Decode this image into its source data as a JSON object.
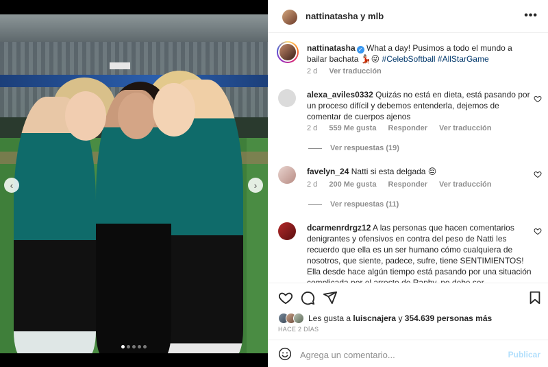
{
  "header": {
    "title": "nattinatasha y mlb",
    "more_icon": "more-horizontal-icon"
  },
  "carousel": {
    "prev_icon": "‹",
    "next_icon": "›",
    "slide_count": 5,
    "active_slide": 1
  },
  "caption": {
    "username": "nattinatasha",
    "verified": "✓",
    "text": "What a day! Pusimos a todo el mundo a bailar bachata 💃🏻😜",
    "hashtags": [
      "#CelebSoftball",
      "#AllStarGame"
    ],
    "age": "2 d",
    "translate": "Ver traducción"
  },
  "comments": [
    {
      "username": "alexa_aviles0332",
      "text": "Quizás no está en dieta, está pasando por un proceso difícil y debemos entenderla, dejemos de comentar de cuerpos ajenos",
      "age": "2 d",
      "likes": "559 Me gusta",
      "reply": "Responder",
      "translate": "Ver traducción",
      "replies": "Ver respuestas (19)"
    },
    {
      "username": "favelyn_24",
      "text": "Natti si esta delgada 😔",
      "age": "2 d",
      "likes": "200 Me gusta",
      "reply": "Responder",
      "translate": "Ver traducción",
      "replies": "Ver respuestas (11)"
    },
    {
      "username": "dcarmenrdrgz12",
      "text": "A las personas que hacen comentarios denigrantes y ofensivos en contra del peso de Natti les recuerdo que ella es un ser humano cómo cualquiera de nosotros, que siente, padece, sufre, tiene SENTIMIENTOS! Ella desde hace algún tiempo está pasando por una situación complicada por el arresto de Raphy, no debe ser"
    }
  ],
  "likes": {
    "prefix": "Les gusta a",
    "user": "luiscnajera",
    "joiner": "y",
    "count": "354.639 personas más"
  },
  "timeago": "HACE 2 DÍAS",
  "add_comment": {
    "placeholder": "Agrega un comentario...",
    "post_label": "Publicar"
  },
  "colors": {
    "link": "#00376b",
    "muted": "#8e8e8e",
    "verified": "#3897f0",
    "post_disabled": "#b2dffc"
  }
}
